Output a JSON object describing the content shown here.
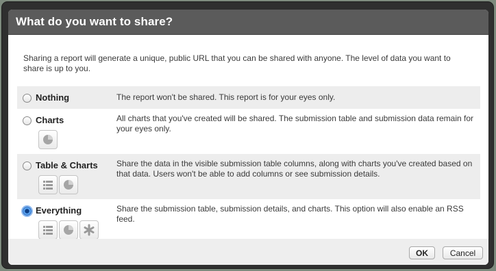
{
  "dialog": {
    "title": "What do you want to share?",
    "intro": "Sharing a report will generate a unique, public URL that you can be shared with anyone. The level of data you want to share is up to you."
  },
  "options": [
    {
      "label": "Nothing",
      "description": "The report won't be shared. This report is for your eyes only.",
      "selected": false,
      "icons": []
    },
    {
      "label": "Charts",
      "description": "All charts that you've created will be shared. The submission table and submission data remain for your eyes only.",
      "selected": false,
      "icons": [
        "pie-chart-icon"
      ]
    },
    {
      "label": "Table & Charts",
      "description": "Share the data in the visible submission table columns, along with charts you've created based on that data. Users won't be able to add columns or see submission details.",
      "selected": false,
      "icons": [
        "table-list-icon",
        "pie-chart-icon"
      ]
    },
    {
      "label": "Everything",
      "description": "Share the submission table, submission details, and charts. This option will also enable an RSS feed.",
      "selected": true,
      "icons": [
        "table-list-icon",
        "pie-chart-icon",
        "asterisk-icon"
      ]
    }
  ],
  "footer": {
    "ok_label": "OK",
    "cancel_label": "Cancel"
  },
  "colors": {
    "titlebar": "#5b5b5b",
    "frame": "#2f2f2f",
    "row_shade": "#ededed",
    "radio_selected": "#2d6fc4"
  }
}
